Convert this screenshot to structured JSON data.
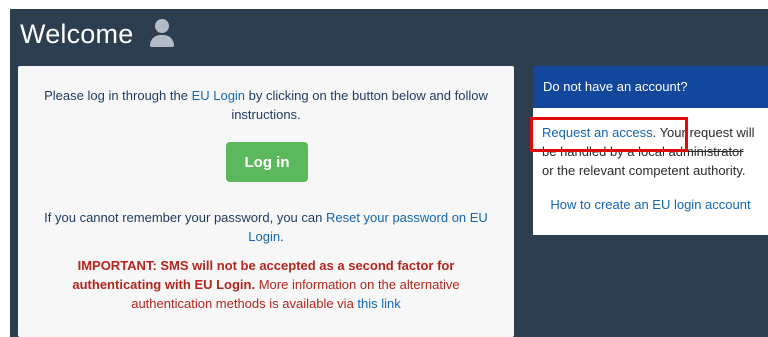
{
  "header": {
    "title": "Welcome",
    "icon": "user-icon"
  },
  "login_card": {
    "intro_prefix": "Please log in through the ",
    "intro_link": "EU Login",
    "intro_suffix": " by clicking on the button below and follow instructions.",
    "login_button": "Log in",
    "reset_prefix": "If you cannot remember your password, you can ",
    "reset_link": "Reset your password on EU Login",
    "reset_suffix": ".",
    "important_bold": "IMPORTANT: SMS will not be accepted as a second factor for authenticating with EU Login.",
    "important_text": " More information on the alternative authentication methods is available via ",
    "important_link": "this link"
  },
  "side_card": {
    "header": "Do not have an account?",
    "request_link": "Request an access",
    "request_text_1": ". Your request will",
    "request_text_2": "be handled by a local administrator",
    "request_text_3": "or the relevant competent authority.",
    "how_link": "How to create an EU login account"
  },
  "colors": {
    "background": "#2c3e4f",
    "accent": "#12479b",
    "button": "#5cb85c",
    "warning": "#b3261e",
    "highlight": "#e10a0a"
  }
}
